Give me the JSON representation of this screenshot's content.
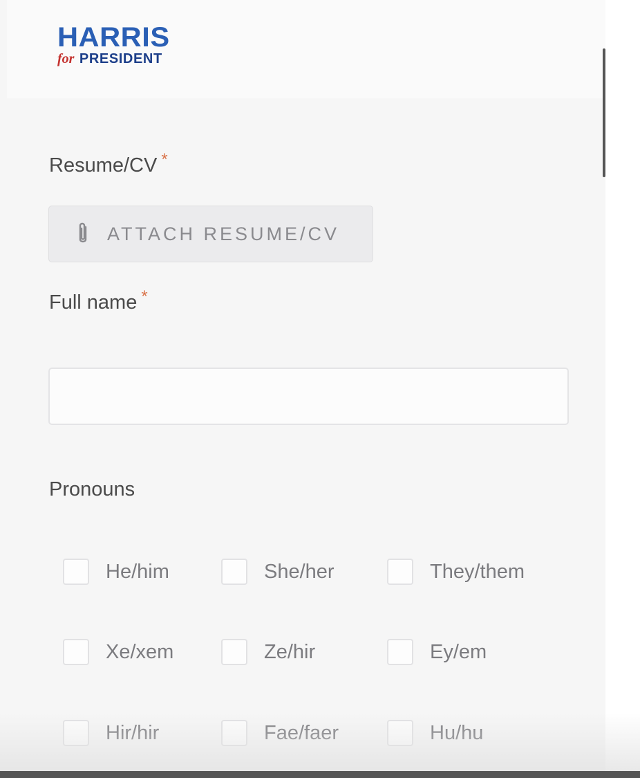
{
  "brand": {
    "line1": "HARRIS",
    "line2_for": "for",
    "line2_president": "PRESIDENT"
  },
  "form": {
    "resume": {
      "label": "Resume/CV",
      "required_mark": "*",
      "attach_button_label": "ATTACH RESUME/CV",
      "attach_icon": "paperclip-icon"
    },
    "full_name": {
      "label": "Full name",
      "required_mark": "*",
      "value": "",
      "placeholder": ""
    },
    "pronouns": {
      "label": "Pronouns",
      "options": [
        {
          "label": "He/him",
          "checked": false
        },
        {
          "label": "She/her",
          "checked": false
        },
        {
          "label": "They/them",
          "checked": false
        },
        {
          "label": "Xe/xem",
          "checked": false
        },
        {
          "label": "Ze/hir",
          "checked": false
        },
        {
          "label": "Ey/em",
          "checked": false
        },
        {
          "label": "Hir/hir",
          "checked": false
        },
        {
          "label": "Fae/faer",
          "checked": false
        },
        {
          "label": "Hu/hu",
          "checked": false
        }
      ]
    }
  },
  "colors": {
    "brand_blue": "#2a5fb5",
    "brand_red": "#c4322f",
    "required_mark": "#d9734a"
  }
}
